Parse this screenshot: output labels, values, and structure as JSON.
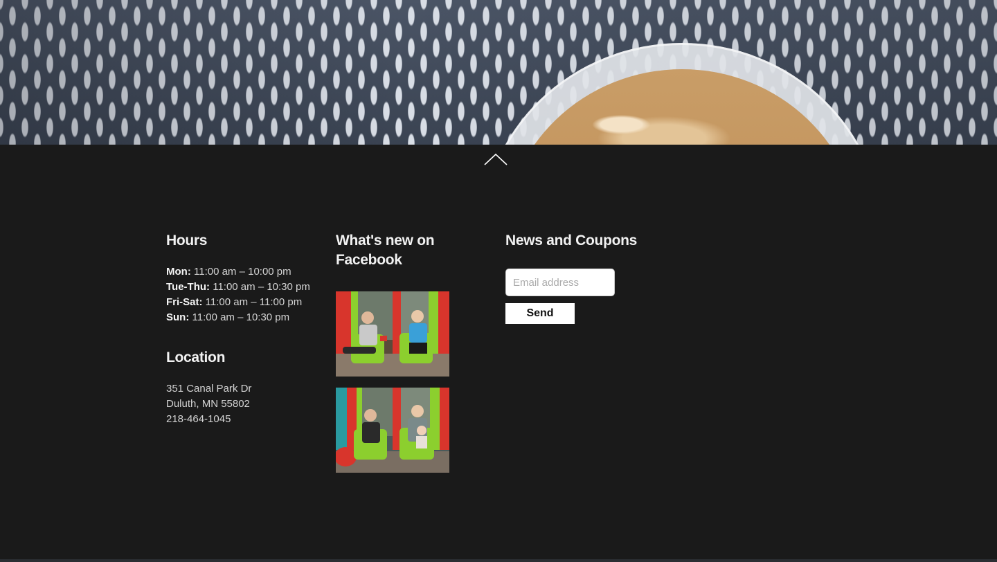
{
  "hours": {
    "title": "Hours",
    "rows": [
      {
        "day": "Mon:",
        "time": "11:00 am – 10:00 pm"
      },
      {
        "day": "Tue-Thu:",
        "time": "11:00 am – 10:30 pm"
      },
      {
        "day": "Fri-Sat:",
        "time": "11:00 am – 11:00 pm"
      },
      {
        "day": "Sun:",
        "time": "11:00 am – 10:30 pm"
      }
    ]
  },
  "location": {
    "title": "Location",
    "address_line1": "351 Canal Park Dr",
    "address_line2": "Duluth, MN 55802",
    "phone": "218-464-1045"
  },
  "facebook": {
    "title": "What's new on Facebook"
  },
  "newsletter": {
    "title": "News and Coupons",
    "email_placeholder": "Email address",
    "send_label": "Send"
  },
  "colors": {
    "background": "#1a1a1a",
    "chair_green": "#8ccf2e",
    "wall_red": "#d8352c"
  }
}
